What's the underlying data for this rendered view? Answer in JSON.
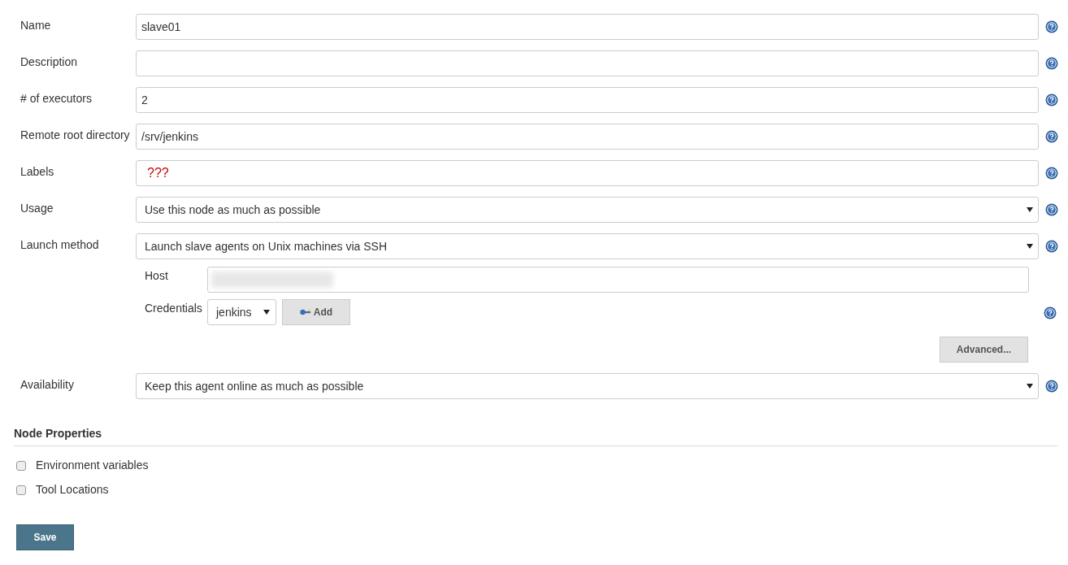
{
  "fields": [
    {
      "label": "Name",
      "kind": "text",
      "value": "slave01"
    },
    {
      "label": "Description",
      "kind": "text"
    },
    {
      "label": "# of executors",
      "kind": "text",
      "value": "2"
    },
    {
      "label": "Remote root directory",
      "kind": "text",
      "value": "/srv/jenkins"
    },
    {
      "label": "Labels",
      "kind": "text",
      "value": "???",
      "error": true
    },
    {
      "label": "Usage",
      "kind": "select",
      "value": "Use this node as much as possible"
    },
    {
      "label": "Launch method",
      "kind": "select",
      "value": "Launch slave agents on Unix machines via SSH",
      "launcher": {
        "host_label": "Host",
        "credentials_label": "Credentials",
        "credentials_value": "jenkins",
        "add_button": "Add",
        "advanced_button": "Advanced..."
      }
    },
    {
      "label": "Availability",
      "kind": "select",
      "value": "Keep this agent online as much as possible"
    }
  ],
  "node_properties": {
    "title": "Node Properties",
    "items": [
      {
        "label": "Environment variables",
        "checked": false
      },
      {
        "label": "Tool Locations",
        "checked": false
      }
    ]
  },
  "save_button": "Save"
}
